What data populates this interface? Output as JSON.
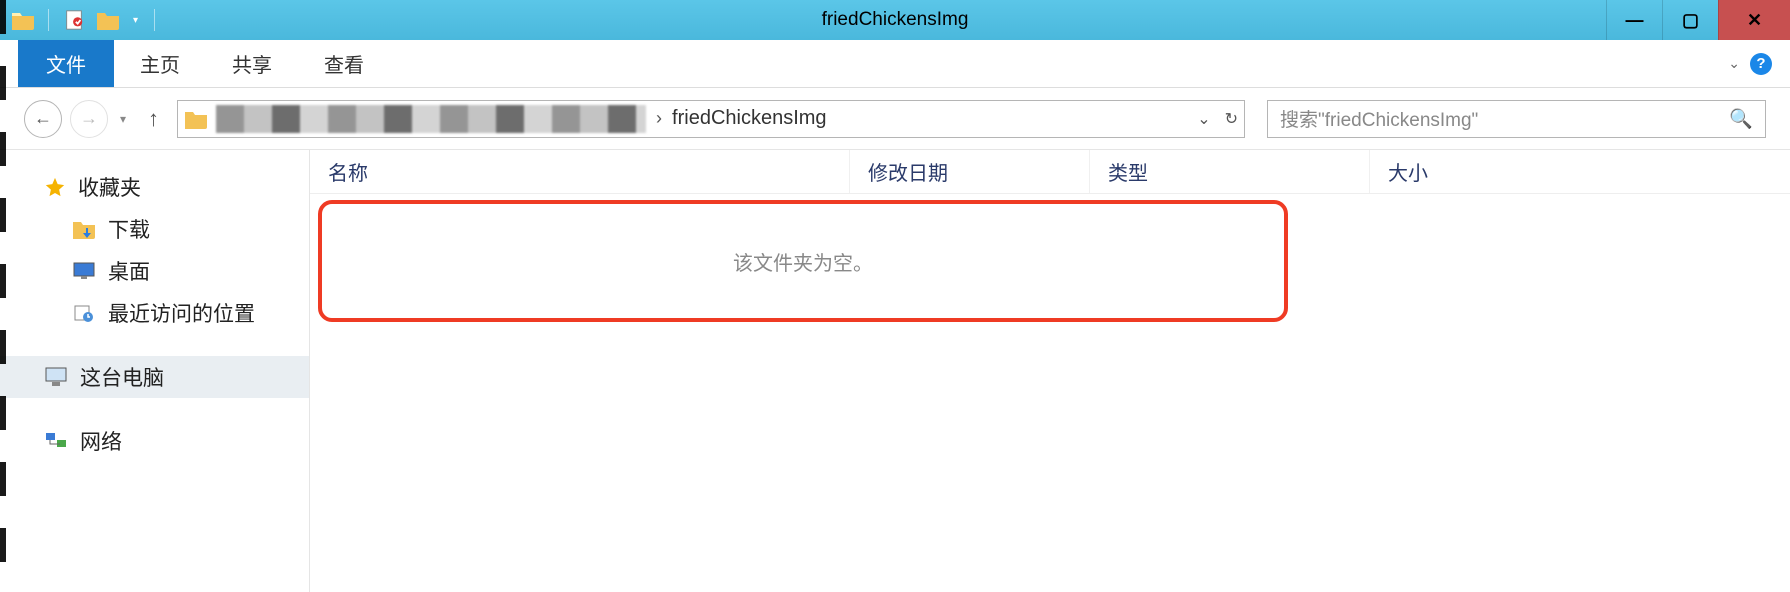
{
  "window": {
    "title": "friedChickensImg"
  },
  "ribbon": {
    "file": "文件",
    "tabs": [
      "主页",
      "共享",
      "查看"
    ]
  },
  "address": {
    "current": "friedChickensImg",
    "breadcrumb_sep": "›",
    "blurred_prefix_visible": true
  },
  "search": {
    "placeholder": "搜索\"friedChickensImg\""
  },
  "sidebar": {
    "favorites": {
      "label": "收藏夹",
      "items": [
        {
          "label": "下载"
        },
        {
          "label": "桌面"
        },
        {
          "label": "最近访问的位置"
        }
      ]
    },
    "this_pc": {
      "label": "这台电脑"
    },
    "network": {
      "label": "网络"
    }
  },
  "columns": {
    "name": "名称",
    "modified": "修改日期",
    "type": "类型",
    "size": "大小"
  },
  "content": {
    "empty_message": "该文件夹为空。"
  },
  "annotation": {
    "highlight_color": "#ef3b24"
  }
}
